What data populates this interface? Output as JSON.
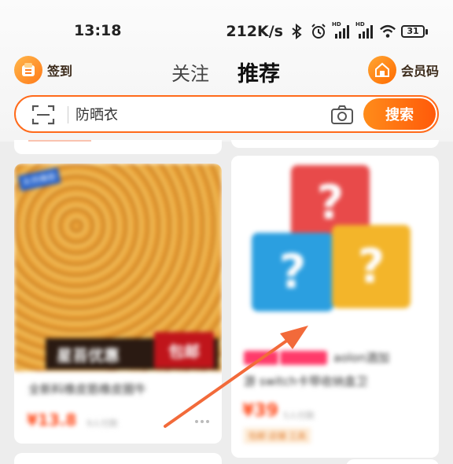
{
  "status_bar": {
    "time": "13:18",
    "net_speed": "212K/s",
    "signal_label": "HD",
    "battery": "31"
  },
  "top_nav": {
    "checkin_label": "签到",
    "tab_follow": "关注",
    "tab_recommend": "推荐",
    "vip_label": "会员码"
  },
  "search": {
    "query": "防晒衣",
    "button_label": "搜索"
  },
  "feed": {
    "left_card": {
      "brand_tag": "天然橡胶",
      "promo_text": "星苔优惠",
      "promo_free": "包邮",
      "title": "全新料橡皮筋橡皮圈牛",
      "price": "¥13.8",
      "sold": "9人付款"
    },
    "right_card": {
      "tag_1": "",
      "tag_2": "",
      "title_line1": "aolon酒加",
      "title_line2": "游 switch卡带收纳盒卫",
      "price": "¥39",
      "sold": "5人付款",
      "coupon": "包邮 店铺 工具"
    }
  },
  "colors": {
    "accent": "#ff6a1a",
    "price": "#ff4a1a",
    "annotation_arrow": "#f26a3a"
  }
}
